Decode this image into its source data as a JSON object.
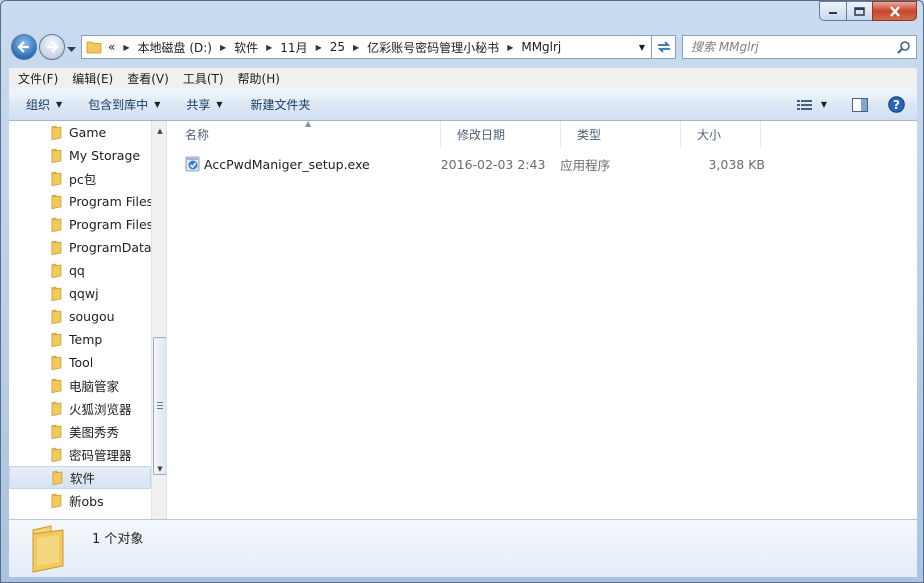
{
  "window": {
    "caption_buttons": {
      "min": "minimize-icon",
      "max": "maximize-icon",
      "close": "close-icon"
    }
  },
  "address": {
    "prefix": "«",
    "crumbs": [
      "本地磁盘 (D:)",
      "软件",
      "11月",
      "25",
      "亿彩账号密码管理小秘书",
      "MMglrj"
    ]
  },
  "search": {
    "placeholder": "搜索 MMglrj"
  },
  "menu": [
    "文件(F)",
    "编辑(E)",
    "查看(V)",
    "工具(T)",
    "帮助(H)"
  ],
  "toolbar": {
    "organize": "组织",
    "include_library": "包含到库中",
    "share": "共享",
    "new_folder": "新建文件夹"
  },
  "navpane": {
    "items": [
      {
        "label": "Game"
      },
      {
        "label": "My Storage"
      },
      {
        "label": "pc包"
      },
      {
        "label": "Program Files"
      },
      {
        "label": "Program Files"
      },
      {
        "label": "ProgramData"
      },
      {
        "label": "qq"
      },
      {
        "label": "qqwj"
      },
      {
        "label": "sougou"
      },
      {
        "label": "Temp"
      },
      {
        "label": "Tool"
      },
      {
        "label": "电脑管家"
      },
      {
        "label": "火狐浏览器"
      },
      {
        "label": "美图秀秀"
      },
      {
        "label": "密码管理器"
      },
      {
        "label": "软件",
        "selected": true
      },
      {
        "label": "新obs"
      }
    ]
  },
  "columns": {
    "name": "名称",
    "date": "修改日期",
    "type": "类型",
    "size": "大小"
  },
  "files": [
    {
      "name": "AccPwdManiger_setup.exe",
      "date": "2016-02-03 2:43",
      "type": "应用程序",
      "size": "3,038 KB",
      "icon": "exe-installer-icon"
    }
  ],
  "details": {
    "count_text": "1 个对象"
  },
  "colors": {
    "accent": "#1b3a66",
    "folder": "#f2c95a",
    "selected": "#d6e3f2"
  }
}
